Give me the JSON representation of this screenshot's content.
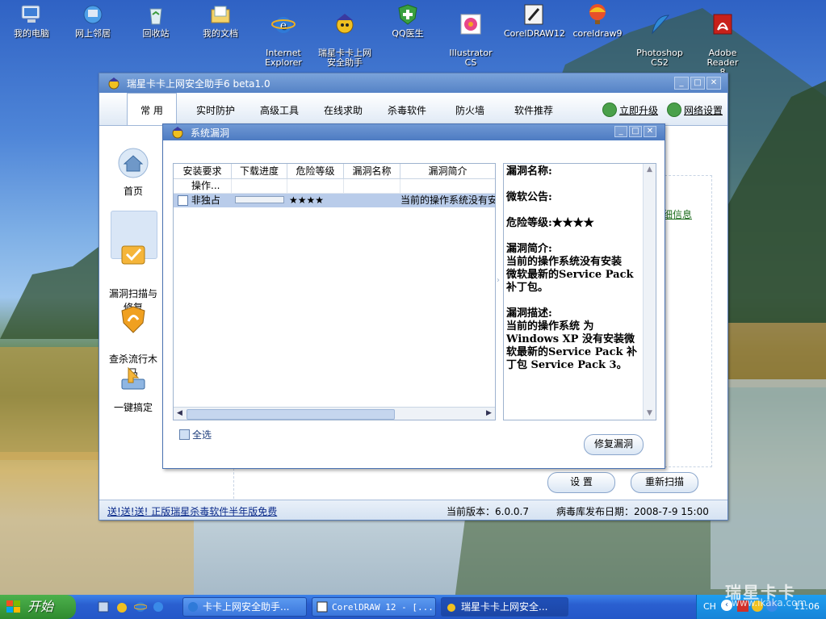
{
  "desktop": {
    "icons": [
      {
        "label": "我的电脑",
        "icon": "computer-icon"
      },
      {
        "label": "网上邻居",
        "icon": "network-icon"
      },
      {
        "label": "回收站",
        "icon": "recycle-bin-icon"
      },
      {
        "label": "我的文档",
        "icon": "documents-icon"
      },
      {
        "label": "Internet\nExplorer",
        "icon": "ie-icon"
      },
      {
        "label": "瑞星卡卡上网\n安全助手",
        "icon": "kaka-icon"
      },
      {
        "label": "QQ医生",
        "icon": "qq-doctor-icon"
      },
      {
        "label": "Illustrator\nCS",
        "icon": "illustrator-icon"
      },
      {
        "label": "CorelDRAW12",
        "icon": "coreldraw12-icon"
      },
      {
        "label": "coreldraw9",
        "icon": "coreldraw9-icon"
      },
      {
        "label": "Photoshop\nCS2",
        "icon": "photoshop-icon"
      },
      {
        "label": "Adobe Reader\n8",
        "icon": "adobe-reader-icon"
      }
    ]
  },
  "main_window": {
    "title": "瑞星卡卡上网安全助手6 beta1.0",
    "nav": {
      "active": "常 用",
      "items": [
        "实时防护",
        "高级工具",
        "在线求助",
        "杀毒软件",
        "防火墙",
        "软件推荐"
      ],
      "upgrade": "立即升级",
      "network": "网络设置"
    },
    "sidebar": [
      {
        "label": "首页",
        "icon": "home-icon"
      },
      {
        "label": "漏洞扫描与\n修复",
        "icon": "vulnerability-scan-icon"
      },
      {
        "label": "查杀流行木\n马",
        "icon": "trojan-kill-icon"
      },
      {
        "label": "一键搞定",
        "icon": "one-click-icon"
      }
    ],
    "detail_link": "细信息",
    "settings_button": "设 置",
    "rescan_button": "重新扫描",
    "status": {
      "promo": "送!送!送! 正版瑞星杀毒软件半年版免费",
      "version": "当前版本：6.0.0.7",
      "virus_db": "病毒库发布日期：2008-7-9 15:00"
    }
  },
  "dialog": {
    "title": "系统漏洞",
    "columns": [
      "安装要求",
      "下载进度",
      "危险等级",
      "漏洞名称",
      "漏洞简介"
    ],
    "sub_header": "操作...",
    "rows": [
      {
        "requirement": "非独占",
        "progress": 0,
        "level": "★★★★",
        "name": "",
        "summary": "当前的操作系统没有安"
      }
    ],
    "select_all": "全选",
    "repair_button": "修复漏洞",
    "detail": {
      "name_label": "漏洞名称:",
      "bulletin_label": "微软公告:",
      "level_line": "危险等级:★★★★",
      "summary": "漏洞简介:\n当前的操作系统没有安装\n微软最新的Service Pack\n补丁包。",
      "description": "漏洞描述:\n当前的操作系统 为\nWindows XP 没有安装微\n软最新的Service Pack 补\n丁包 Service Pack 3。"
    }
  },
  "taskbar": {
    "start": "开始",
    "tasks": [
      {
        "label": "卡卡上网安全助手...",
        "icon": "ie-icon"
      },
      {
        "label": "CorelDRAW 12 - [...",
        "icon": "coreldraw-icon"
      },
      {
        "label": "瑞星卡卡上网安全...",
        "icon": "kaka-icon"
      }
    ],
    "lang": "CH",
    "clock": "11:06"
  },
  "watermark": {
    "brand": "瑞星卡卡",
    "url": "www.ikaka.com"
  }
}
